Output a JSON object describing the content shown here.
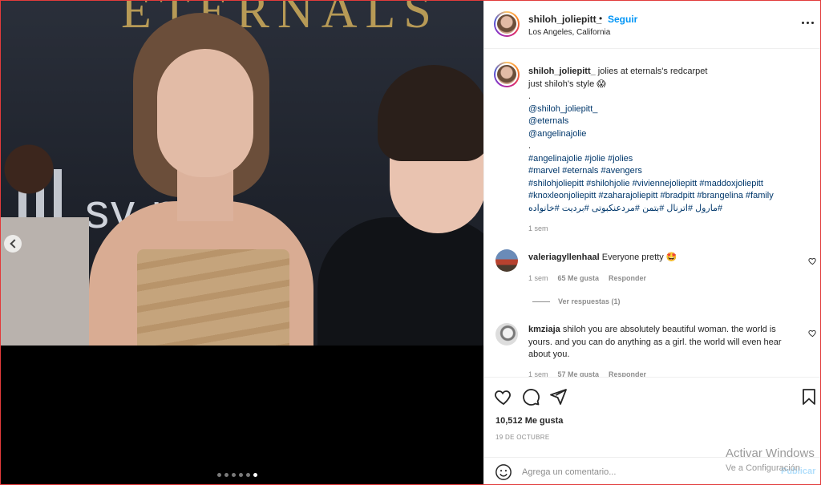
{
  "media": {
    "brand_text": "ETERNALS",
    "sponsor_text": "sy      ny",
    "carousel": {
      "count": 6,
      "active_index": 5
    }
  },
  "header": {
    "username": "shiloh_joliepitt_",
    "separator": "•",
    "follow_label": "Seguir",
    "location": "Los Angeles, California",
    "more_icon": "more-horizontal-icon"
  },
  "caption": {
    "username": "shiloh_joliepitt_",
    "lines": [
      "jolies at eternals's redcarpet",
      "just shiloh's style 😱",
      ".",
      "@shiloh_joliepitt_",
      "@eternals",
      "@angelinajolie",
      ".",
      "#angelinajolie #jolie #jolies",
      "#marvel #eternals #avengers",
      "#shilohjoliepitt #shilohjolie #viviennejoliepitt #maddoxjoliepitt",
      "#knoxleonjoliepitt #zaharajoliepitt #bradpitt #brangelina #family",
      "مارول #اترنال #بتمن #مردعنکبوتی #برديت #خانواده#"
    ],
    "time": "1 sem"
  },
  "comments": [
    {
      "username": "valeriagyllenhaal",
      "text": "Everyone pretty 🤩",
      "time": "1 sem",
      "likes": "65 Me gusta",
      "reply_label": "Responder",
      "view_replies": "Ver respuestas (1)"
    },
    {
      "username": "kmziaja",
      "text": "shiloh you are absolutely beautiful woman. the world is yours. and you can do anything as a girl. the world will even hear about you.",
      "time": "1 sem",
      "likes": "57 Me gusta",
      "reply_label": "Responder"
    }
  ],
  "actions": {
    "like_icon": "heart-icon",
    "comment_icon": "comment-icon",
    "share_icon": "paper-plane-icon",
    "save_icon": "bookmark-icon",
    "likes_count": "10,512 Me gusta",
    "date": "19 DE OCTUBRE"
  },
  "add_comment": {
    "placeholder": "Agrega un comentario...",
    "post_label": "Publicar"
  },
  "watermark": {
    "title": "Activar Windows",
    "subtitle": "Ve a Configuración"
  },
  "colors": {
    "link_blue": "#0095f6",
    "tag_blue": "#00376b",
    "muted": "#8e8e8e",
    "frame_red": "#e23b3b"
  }
}
